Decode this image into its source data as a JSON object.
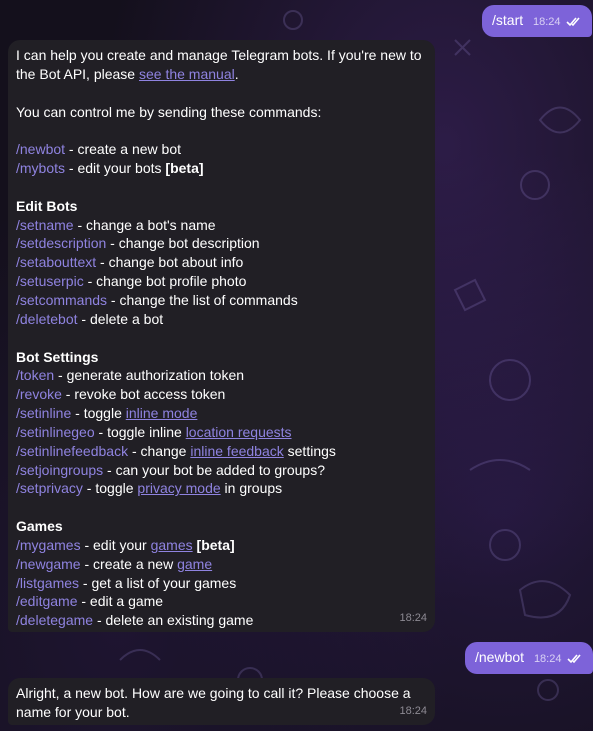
{
  "out1": {
    "text": "/start",
    "time": "18:24"
  },
  "bot1": {
    "intro1": "I can help you create and manage Telegram bots. If you're new to",
    "intro2a": "the Bot API, please ",
    "intro2link": "see the manual",
    "intro2b": ".",
    "control": "You can control me by sending these commands:",
    "newbot": {
      "cmd": "/newbot",
      "desc": " - create a new bot"
    },
    "mybots": {
      "cmd": "/mybots",
      "desc": " - edit your bots ",
      "beta": "[beta]"
    },
    "edit_heading": "Edit Bots",
    "edit": [
      {
        "cmd": "/setname",
        "desc": " - change a bot's name"
      },
      {
        "cmd": "/setdescription",
        "desc": " - change bot description"
      },
      {
        "cmd": "/setabouttext",
        "desc": " - change bot about info"
      },
      {
        "cmd": "/setuserpic",
        "desc": " - change bot profile photo"
      },
      {
        "cmd": "/setcommands",
        "desc": " - change the list of commands"
      },
      {
        "cmd": "/deletebot",
        "desc": " - delete a bot"
      }
    ],
    "settings_heading": "Bot Settings",
    "token": {
      "cmd": "/token",
      "desc": " - generate authorization token"
    },
    "revoke": {
      "cmd": "/revoke",
      "desc": " - revoke bot access token"
    },
    "setinline": {
      "cmd": "/setinline",
      "desc": " - toggle ",
      "link": "inline mode"
    },
    "setinlinegeo": {
      "cmd": "/setinlinegeo",
      "desc": " - toggle inline ",
      "link": "location requests"
    },
    "setinlinefeedback": {
      "cmd": "/setinlinefeedback",
      "desc": " - change ",
      "link": "inline feedback",
      "after": " settings"
    },
    "setjoingroups": {
      "cmd": "/setjoingroups",
      "desc": " - can your bot be added to groups?"
    },
    "setprivacy": {
      "cmd": "/setprivacy",
      "desc": " - toggle ",
      "link": "privacy mode",
      "after": " in groups"
    },
    "games_heading": "Games",
    "mygames": {
      "cmd": "/mygames",
      "desc": " - edit your ",
      "link": "games",
      "beta": "[beta]"
    },
    "newgame": {
      "cmd": "/newgame",
      "desc": " - create a new ",
      "link": "game"
    },
    "listgames": {
      "cmd": "/listgames",
      "desc": " - get a list of your games"
    },
    "editgame": {
      "cmd": "/editgame",
      "desc": " - edit a game"
    },
    "deletegame": {
      "cmd": "/deletegame",
      "desc": " - delete an existing game"
    },
    "time": "18:24"
  },
  "out2": {
    "text": "/newbot",
    "time": "18:24"
  },
  "bot2": {
    "line1": "Alright, a new bot. How are we going to call it? Please choose a",
    "line2": "name for your bot.",
    "time": "18:24"
  },
  "colors": {
    "accent": "#7d63d9",
    "command": "#8f83e0",
    "incoming_bg": "#211f25"
  }
}
